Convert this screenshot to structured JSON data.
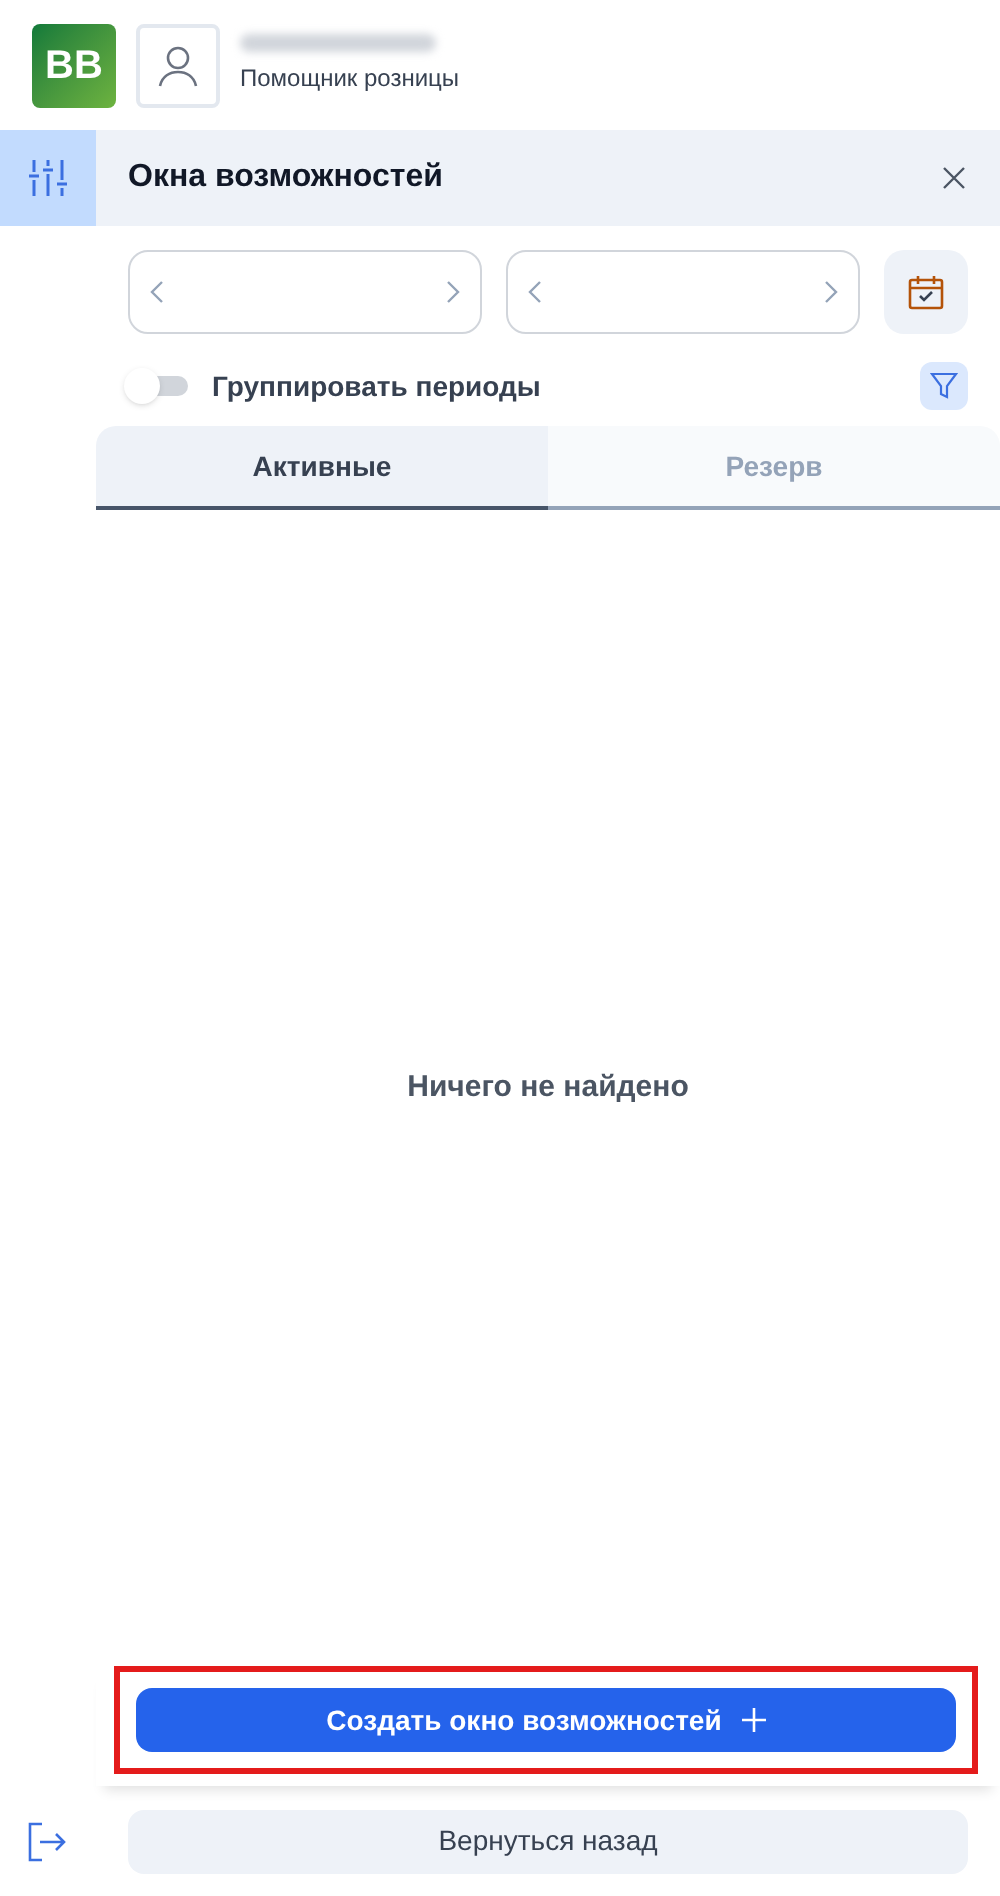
{
  "header": {
    "logo": "BB",
    "user_role": "Помощник розницы"
  },
  "sidebar": {
    "items": [
      {
        "kind": "filters",
        "selected": true
      }
    ]
  },
  "panel": {
    "title": "Окна возможностей",
    "toggle": {
      "label": "Группировать периоды",
      "on": false
    },
    "tabs": [
      {
        "label": "Активные",
        "selected": true
      },
      {
        "label": "Резерв",
        "selected": false
      }
    ],
    "empty_message": "Ничего не найдено",
    "create_button": {
      "label": "Создать окно возможностей",
      "highlighted": true
    }
  },
  "back_button": {
    "label": "Вернуться назад"
  }
}
